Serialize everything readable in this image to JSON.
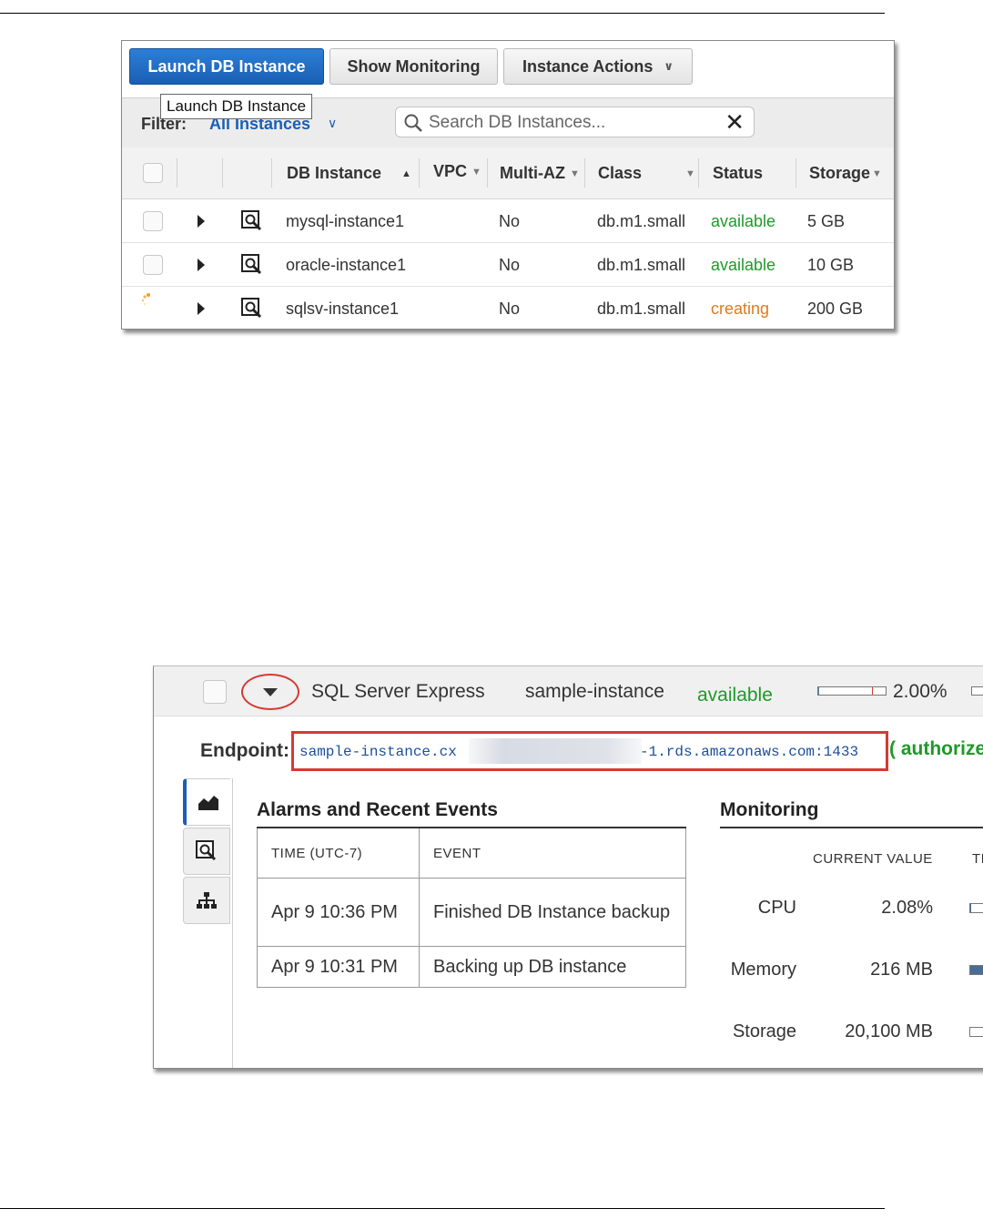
{
  "top_panel": {
    "toolbar": {
      "launch_label": "Launch DB Instance",
      "monitoring_label": "Show Monitoring",
      "actions_label": "Instance Actions",
      "tooltip": "Launch DB Instance"
    },
    "filter": {
      "label": "Filter:",
      "value": "All Instances",
      "search_placeholder": "Search DB Instances..."
    },
    "columns": [
      "DB Instance",
      "VPC",
      "Multi-AZ",
      "Class",
      "Status",
      "Storage"
    ],
    "rows": [
      {
        "name": "mysql-instance1",
        "multi_az": "No",
        "class": "db.m1.small",
        "status": "available",
        "storage": "5 GB"
      },
      {
        "name": "oracle-instance1",
        "multi_az": "No",
        "class": "db.m1.small",
        "status": "available",
        "storage": "10 GB"
      },
      {
        "name": "sqlsv-instance1",
        "multi_az": "No",
        "class": "db.m1.small",
        "status": "creating",
        "storage": "200 GB"
      }
    ],
    "colors": {
      "available": "#1e9a2a",
      "creating": "#e07b1a",
      "primary": "#1a5fb4"
    }
  },
  "detail_panel": {
    "engine": "SQL Server Express",
    "instance": "sample-instance",
    "status": "available",
    "cpu_percent": "2.00%",
    "cpu_fraction": 0.02,
    "endpoint_label": "Endpoint:",
    "endpoint_start": "sample-instance.cx",
    "endpoint_end": "-1.rds.amazonaws.com:1433",
    "authorize": "( authorize",
    "alarms": {
      "title": "Alarms and Recent Events",
      "col_time": "TIME (UTC-7)",
      "col_event": "EVENT",
      "rows": [
        {
          "time": "Apr 9 10:36 PM",
          "event": "Finished DB Instance backup"
        },
        {
          "time": "Apr 9 10:31 PM",
          "event": "Backing up DB instance"
        }
      ]
    },
    "monitoring": {
      "title": "Monitoring",
      "col_current": "CURRENT VALUE",
      "col_threshold": "TI",
      "metrics": [
        {
          "label": "CPU",
          "value": "2.08%",
          "fraction": 0.02
        },
        {
          "label": "Memory",
          "value": "216 MB",
          "fraction": 0.6
        },
        {
          "label": "Storage",
          "value": "20,100 MB",
          "fraction": 0.0
        }
      ]
    }
  }
}
